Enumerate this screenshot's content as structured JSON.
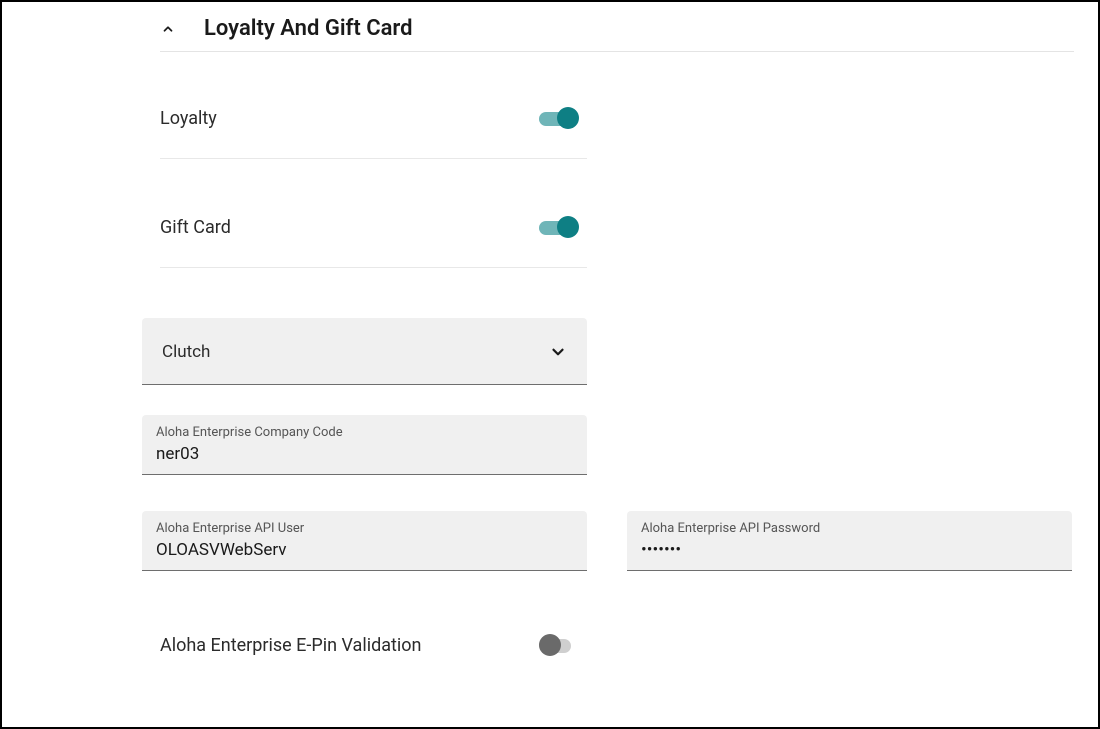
{
  "section": {
    "title": "Loyalty And Gift Card"
  },
  "toggles": {
    "loyalty": {
      "label": "Loyalty",
      "on": true
    },
    "giftcard": {
      "label": "Gift Card",
      "on": true
    },
    "epin": {
      "label": "Aloha Enterprise E-Pin Validation",
      "on": false
    }
  },
  "provider": {
    "selected": "Clutch"
  },
  "fields": {
    "companyCode": {
      "label": "Aloha Enterprise Company Code",
      "value": "ner03"
    },
    "apiUser": {
      "label": "Aloha Enterprise API User",
      "value": "OLOASVWebServ"
    },
    "apiPassword": {
      "label": "Aloha Enterprise API Password",
      "value": "•••••••"
    }
  }
}
